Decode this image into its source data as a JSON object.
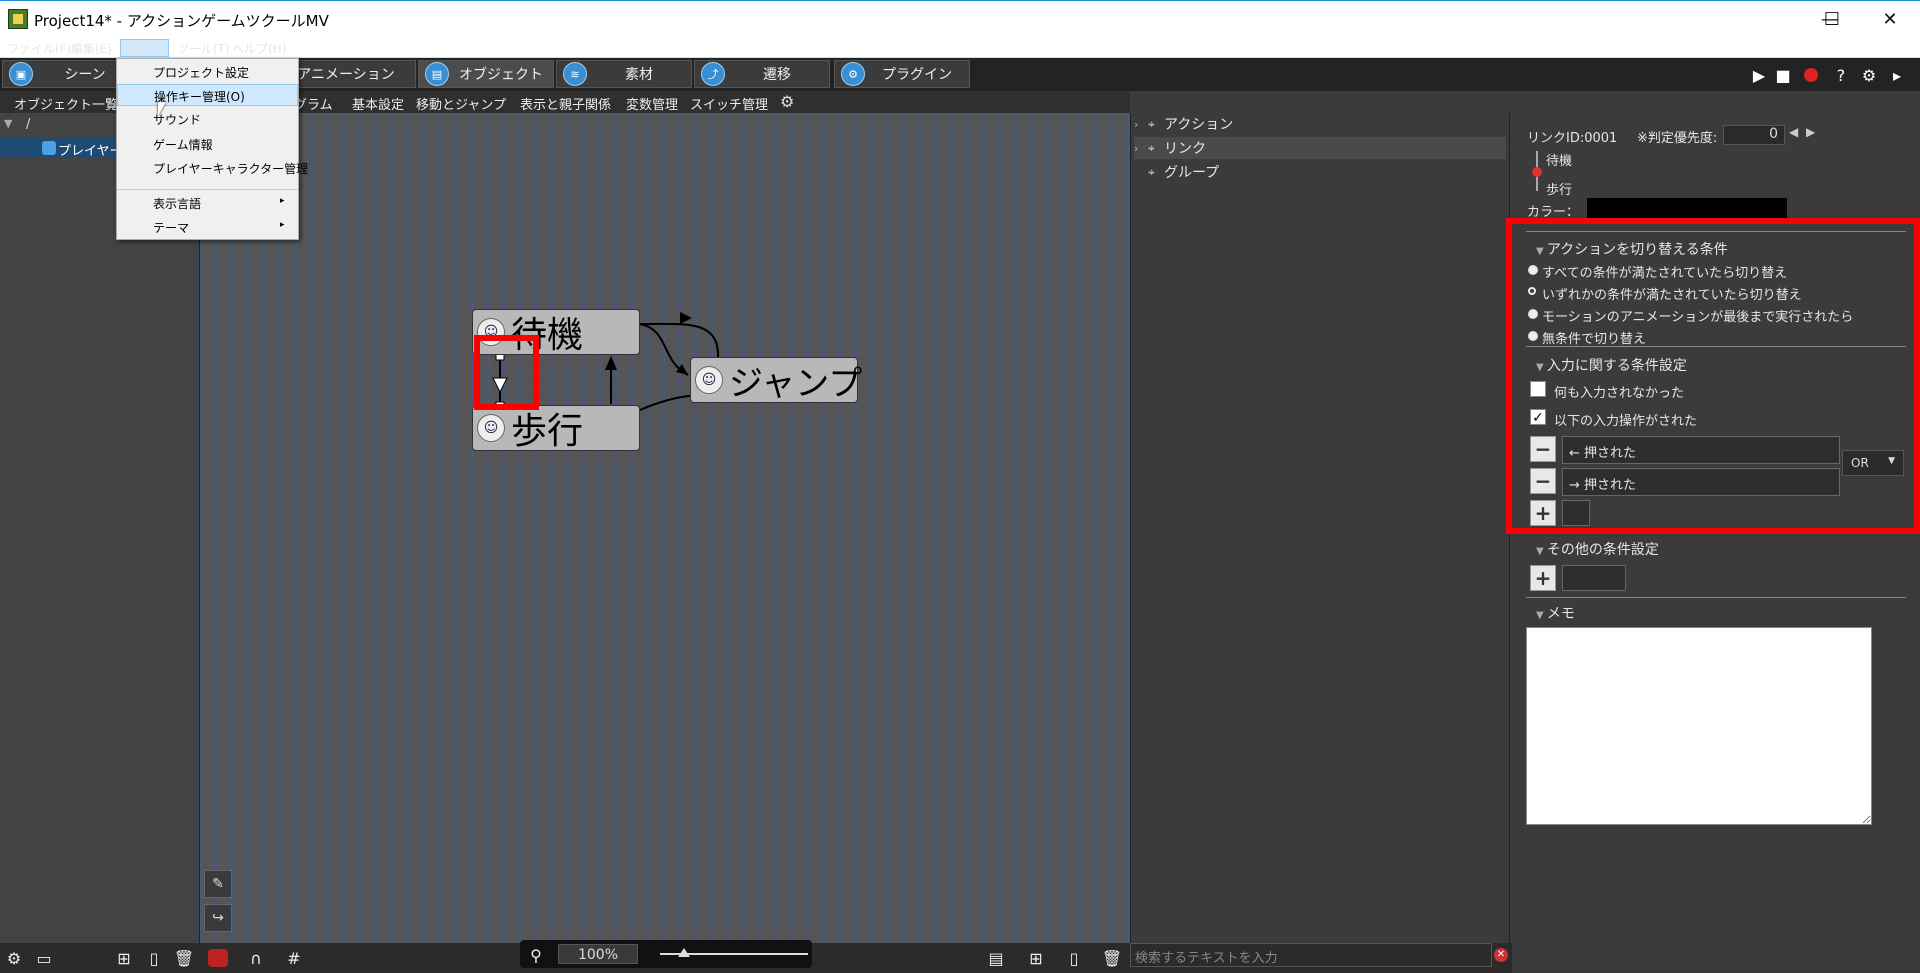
{
  "window": {
    "title": "Project14* - アクションゲームツクールMV",
    "controls": {
      "minimize": "—",
      "maximize": "☐",
      "close": "✕"
    }
  },
  "menubar": {
    "items": [
      "ファイル(F)",
      "編集(E)",
      "設定(S)",
      "ツール(T)",
      "ヘルプ(H)"
    ]
  },
  "settings_menu": {
    "items": [
      "プロジェクト設定",
      "操作キー管理(O)",
      "サウンド",
      "ゲーム情報",
      "プレイヤーキャラクター管理",
      "表示言語",
      "テーマ"
    ],
    "highlighted": "操作キー管理(O)",
    "submenu_arrow": "▸"
  },
  "tabs": {
    "items": [
      "シーン",
      "アニメーション",
      "オブジェクト",
      "素材",
      "遷移",
      "プラグイン"
    ],
    "active": "オブジェクト"
  },
  "toolbar_right": {
    "help": "?"
  },
  "subtabs": {
    "items": [
      "オブジェクト一覧",
      "グラム",
      "基本設定",
      "移動とジャンプ",
      "表示と親子関係",
      "変数管理",
      "スイッチ管理"
    ]
  },
  "tree": {
    "root": "/",
    "expander": "▼",
    "items": [
      "プレイヤー"
    ]
  },
  "canvas": {
    "nodes": {
      "wait": "待機",
      "walk": "歩行",
      "jump": "ジャンプ"
    }
  },
  "zoom": {
    "value": "100%"
  },
  "list_panel": {
    "items": [
      "アクション",
      "リンク",
      "グループ"
    ],
    "selected": "リンク",
    "search_placeholder": "検索するテキストを入力"
  },
  "link_props": {
    "link_id_label": "リンクID:0001",
    "priority_label": "※判定優先度:",
    "priority_value": "0",
    "from": "待機",
    "to": "歩行",
    "color_label": "カラー：",
    "color_value": "#000000"
  },
  "switch_conditions": {
    "title": "アクションを切り替える条件",
    "options": [
      "すべての条件が満たされていたら切り替え",
      "いずれかの条件が満たされていたら切り替え",
      "モーションのアニメーションが最後まで実行されたら",
      "無条件で切り替え"
    ],
    "selected": "いずれかの条件が満たされていたら切り替え"
  },
  "input_conditions": {
    "title": "入力に関する条件設定",
    "no_input_label": "何も入力されなかった",
    "no_input_checked": false,
    "following_input_label": "以下の入力操作がされた",
    "following_input_checked": true,
    "inputs": [
      "← 押された",
      "→ 押された"
    ],
    "combine": "OR"
  },
  "other_conditions": {
    "title": "その他の条件設定"
  },
  "memo": {
    "title": "メモ",
    "value": ""
  },
  "colors": {
    "highlight_frame": "#ff0000",
    "accent_blue": "#1e8fd6",
    "grid_line": "#3c5ac8"
  }
}
